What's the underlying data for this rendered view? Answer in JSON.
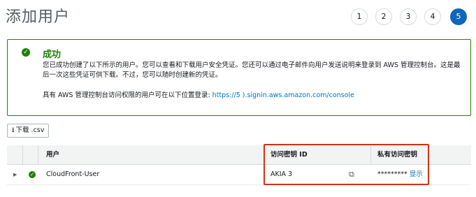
{
  "page": {
    "title": "添加用户"
  },
  "steps": [
    "1",
    "2",
    "3",
    "4",
    "5"
  ],
  "alert": {
    "icon": "check-circle-icon",
    "heading": "成功",
    "message": "您已成功创建了以下所示的用户。您可以查看和下载用户安全凭证。您还可以通过电子邮件向用户发送说明来登录到 AWS 管理控制台。这是最后一次这些凭证可供下载。不过，您可以随时创建新的凭证。",
    "console_text": "具有 AWS 管理控制台访问权限的用户可在以下位置登录: ",
    "console_link": "https://5                         ).signin.aws.amazon.com/console"
  },
  "download": {
    "label": "下载 .csv",
    "icon": "download-icon"
  },
  "table": {
    "columns": [
      "用户",
      "访问密钥 ID",
      "私有访问密钥"
    ],
    "rows": [
      {
        "user": "CloudFront-User",
        "access_key_id": "AKIA                              3",
        "secret": "*********",
        "show": "显示"
      }
    ]
  },
  "colors": {
    "success": "#1d8102",
    "accent": "#1166bb",
    "link": "#0073bb",
    "highlight": "#d13212"
  }
}
